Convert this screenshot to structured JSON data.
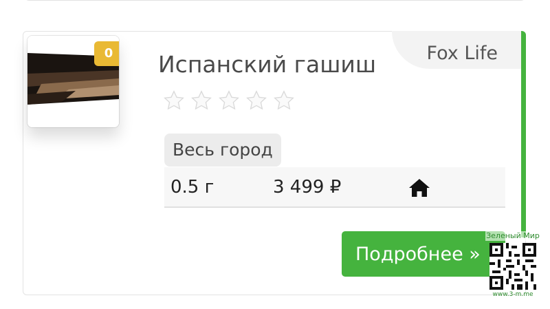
{
  "product": {
    "stock_count": "0",
    "title": "Испанский гашиш",
    "seller": "Fox Life",
    "rating": 0,
    "rating_max": 5,
    "region": "Весь город",
    "offer": {
      "quantity": "0.5 г",
      "price": "3 499 ₽",
      "delivery_icon": "home-icon"
    },
    "details_label": "Подробнее »"
  },
  "watermark": {
    "top_text": "Зеленый Мир",
    "bottom_text": "www.3-m.me"
  },
  "colors": {
    "accent_green": "#45b33e",
    "badge_yellow": "#e9b934",
    "seller_tab_bg": "#f3f3f3"
  }
}
